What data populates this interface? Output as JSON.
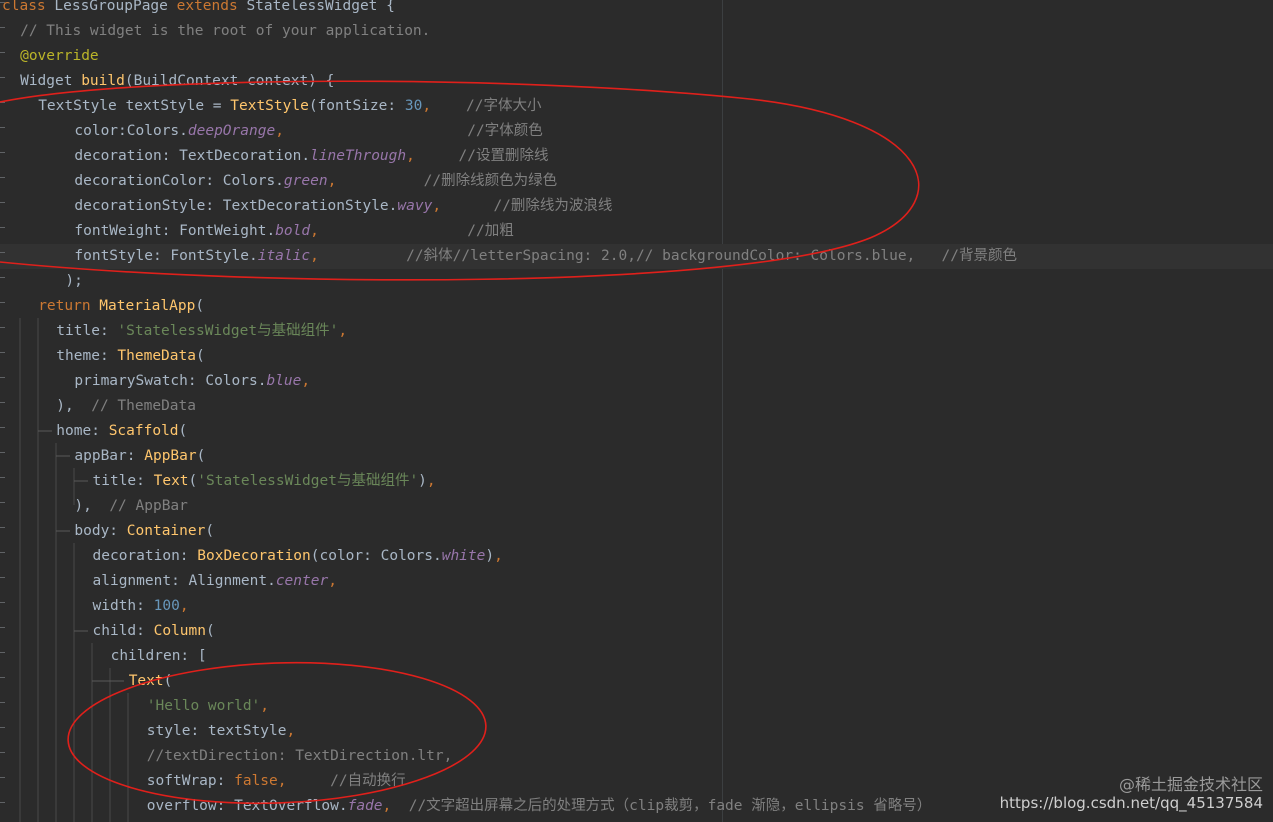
{
  "lines": [
    {
      "indent": 0,
      "parts": [
        {
          "c": "kw",
          "t": "class "
        },
        {
          "c": "cz",
          "t": "LessGroupPage "
        },
        {
          "c": "kw",
          "t": "extends "
        },
        {
          "c": "cz",
          "t": "StatelessWidget {"
        }
      ]
    },
    {
      "indent": 2,
      "parts": [
        {
          "c": "cmt",
          "t": "// This widget is the root of your application."
        }
      ]
    },
    {
      "indent": 2,
      "parts": [
        {
          "c": "ann",
          "t": "@override"
        }
      ]
    },
    {
      "indent": 2,
      "parts": [
        {
          "c": "cz",
          "t": "Widget "
        },
        {
          "c": "fn",
          "t": "build"
        },
        {
          "c": "cz",
          "t": "(BuildContext context) {"
        }
      ]
    },
    {
      "indent": 4,
      "parts": [
        {
          "c": "cz",
          "t": "TextStyle textStyle = "
        },
        {
          "c": "fn",
          "t": "TextStyle"
        },
        {
          "c": "cz",
          "t": "(fontSize: "
        },
        {
          "c": "num",
          "t": "30"
        },
        {
          "c": "kw",
          "t": ","
        },
        {
          "c": "cz",
          "t": "    "
        },
        {
          "c": "cmt",
          "t": "//字体大小"
        }
      ]
    },
    {
      "indent": 8,
      "parts": [
        {
          "c": "cz",
          "t": "color:Colors."
        },
        {
          "c": "field",
          "t": "deepOrange"
        },
        {
          "c": "kw",
          "t": ","
        },
        {
          "c": "cz",
          "t": "                     "
        },
        {
          "c": "cmt",
          "t": "//字体颜色"
        }
      ]
    },
    {
      "indent": 8,
      "parts": [
        {
          "c": "cz",
          "t": "decoration: TextDecoration."
        },
        {
          "c": "field",
          "t": "lineThrough"
        },
        {
          "c": "kw",
          "t": ","
        },
        {
          "c": "cz",
          "t": "     "
        },
        {
          "c": "cmt",
          "t": "//设置删除线"
        }
      ]
    },
    {
      "indent": 8,
      "parts": [
        {
          "c": "cz",
          "t": "decorationColor: Colors."
        },
        {
          "c": "field",
          "t": "green"
        },
        {
          "c": "kw",
          "t": ","
        },
        {
          "c": "cz",
          "t": "          "
        },
        {
          "c": "cmt",
          "t": "//删除线颜色为绿色"
        }
      ]
    },
    {
      "indent": 8,
      "parts": [
        {
          "c": "cz",
          "t": "decorationStyle: TextDecorationStyle."
        },
        {
          "c": "field",
          "t": "wavy"
        },
        {
          "c": "kw",
          "t": ","
        },
        {
          "c": "cz",
          "t": "      "
        },
        {
          "c": "cmt",
          "t": "//删除线为波浪线"
        }
      ]
    },
    {
      "indent": 8,
      "parts": [
        {
          "c": "cz",
          "t": "fontWeight: FontWeight."
        },
        {
          "c": "field",
          "t": "bold"
        },
        {
          "c": "kw",
          "t": ","
        },
        {
          "c": "cz",
          "t": "                 "
        },
        {
          "c": "cmt",
          "t": "//加粗"
        }
      ]
    },
    {
      "indent": 8,
      "caret": true,
      "parts": [
        {
          "c": "cz",
          "t": "fontStyle: FontStyle."
        },
        {
          "c": "field",
          "t": "italic"
        },
        {
          "c": "kw",
          "t": ","
        },
        {
          "c": "cz",
          "t": "          "
        },
        {
          "c": "cmt",
          "t": "//斜体//letterSpacing: 2.0,// backgroundColor: Colors.blue,   //背景颜色"
        }
      ]
    },
    {
      "indent": 7,
      "parts": [
        {
          "c": "cz",
          "t": ");"
        }
      ]
    },
    {
      "indent": 4,
      "parts": [
        {
          "c": "kw",
          "t": "return "
        },
        {
          "c": "fn",
          "t": "MaterialApp"
        },
        {
          "c": "cz",
          "t": "("
        }
      ]
    },
    {
      "indent": 6,
      "parts": [
        {
          "c": "cz",
          "t": "title: "
        },
        {
          "c": "str",
          "t": "'StatelessWidget与基础组件'"
        },
        {
          "c": "kw",
          "t": ","
        }
      ]
    },
    {
      "indent": 6,
      "parts": [
        {
          "c": "cz",
          "t": "theme: "
        },
        {
          "c": "fn",
          "t": "ThemeData"
        },
        {
          "c": "cz",
          "t": "("
        }
      ]
    },
    {
      "indent": 8,
      "parts": [
        {
          "c": "cz",
          "t": "primarySwatch: Colors."
        },
        {
          "c": "field",
          "t": "blue"
        },
        {
          "c": "kw",
          "t": ","
        }
      ]
    },
    {
      "indent": 6,
      "parts": [
        {
          "c": "cz",
          "t": "),"
        },
        {
          "c": "cmt",
          "t": "  // ThemeData"
        }
      ]
    },
    {
      "indent": 6,
      "parts": [
        {
          "c": "cz",
          "t": "home: "
        },
        {
          "c": "fn",
          "t": "Scaffold"
        },
        {
          "c": "cz",
          "t": "("
        }
      ]
    },
    {
      "indent": 8,
      "parts": [
        {
          "c": "cz",
          "t": "appBar: "
        },
        {
          "c": "fn",
          "t": "AppBar"
        },
        {
          "c": "cz",
          "t": "("
        }
      ]
    },
    {
      "indent": 10,
      "parts": [
        {
          "c": "cz",
          "t": "title: "
        },
        {
          "c": "fn",
          "t": "Text"
        },
        {
          "c": "cz",
          "t": "("
        },
        {
          "c": "str",
          "t": "'StatelessWidget与基础组件'"
        },
        {
          "c": "cz",
          "t": ")"
        },
        {
          "c": "kw",
          "t": ","
        }
      ]
    },
    {
      "indent": 8,
      "parts": [
        {
          "c": "cz",
          "t": "),"
        },
        {
          "c": "cmt",
          "t": "  // AppBar"
        }
      ]
    },
    {
      "indent": 8,
      "parts": [
        {
          "c": "cz",
          "t": "body: "
        },
        {
          "c": "fn",
          "t": "Container"
        },
        {
          "c": "cz",
          "t": "("
        }
      ]
    },
    {
      "indent": 10,
      "parts": [
        {
          "c": "cz",
          "t": "decoration: "
        },
        {
          "c": "fn",
          "t": "BoxDecoration"
        },
        {
          "c": "cz",
          "t": "(color: Colors."
        },
        {
          "c": "field",
          "t": "white"
        },
        {
          "c": "cz",
          "t": ")"
        },
        {
          "c": "kw",
          "t": ","
        }
      ]
    },
    {
      "indent": 10,
      "parts": [
        {
          "c": "cz",
          "t": "alignment: Alignment."
        },
        {
          "c": "field",
          "t": "center"
        },
        {
          "c": "kw",
          "t": ","
        }
      ]
    },
    {
      "indent": 10,
      "parts": [
        {
          "c": "cz",
          "t": "width: "
        },
        {
          "c": "num",
          "t": "100"
        },
        {
          "c": "kw",
          "t": ","
        }
      ]
    },
    {
      "indent": 10,
      "parts": [
        {
          "c": "cz",
          "t": "child: "
        },
        {
          "c": "fn",
          "t": "Column"
        },
        {
          "c": "cz",
          "t": "("
        }
      ]
    },
    {
      "indent": 12,
      "parts": [
        {
          "c": "cz",
          "t": "children: ["
        }
      ]
    },
    {
      "indent": 14,
      "parts": [
        {
          "c": "fn",
          "t": "Text"
        },
        {
          "c": "cz",
          "t": "("
        }
      ]
    },
    {
      "indent": 16,
      "parts": [
        {
          "c": "str",
          "t": "'Hello world'"
        },
        {
          "c": "kw",
          "t": ","
        }
      ]
    },
    {
      "indent": 16,
      "parts": [
        {
          "c": "cz",
          "t": "style: textStyle"
        },
        {
          "c": "kw",
          "t": ","
        }
      ]
    },
    {
      "indent": 16,
      "parts": [
        {
          "c": "cmt",
          "t": "//textDirection: TextDirection.ltr,"
        }
      ]
    },
    {
      "indent": 16,
      "parts": [
        {
          "c": "cz",
          "t": "softWrap: "
        },
        {
          "c": "kw",
          "t": "false,"
        },
        {
          "c": "cz",
          "t": "     "
        },
        {
          "c": "cmt",
          "t": "//自动换行"
        }
      ]
    },
    {
      "indent": 16,
      "parts": [
        {
          "c": "cz",
          "t": "overflow: TextOverflow."
        },
        {
          "c": "field",
          "t": "fade"
        },
        {
          "c": "kw",
          "t": ","
        },
        {
          "c": "cz",
          "t": "  "
        },
        {
          "c": "cmt",
          "t": "//文字超出屏幕之后的处理方式（clip裁剪，fade 渐隐，ellipsis 省略号）"
        }
      ]
    }
  ],
  "watermark": {
    "line1": "@稀土掘金技术社区",
    "line2": "https://blog.csdn.net/qq_45137584"
  },
  "colors": {
    "background": "#2b2b2b",
    "annotation_circle": "#e0201b"
  }
}
